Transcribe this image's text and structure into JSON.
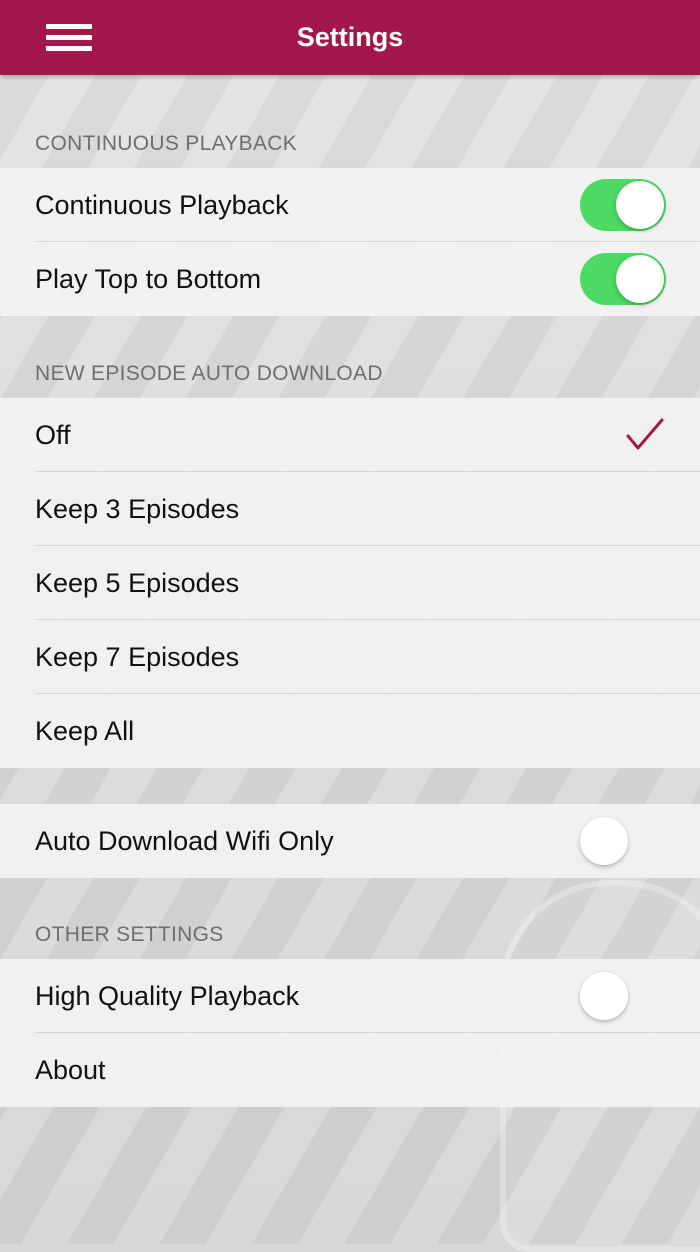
{
  "nav": {
    "title": "Settings",
    "menu_icon": "hamburger-menu-icon"
  },
  "sections": {
    "continuous": {
      "header": "CONTINUOUS PLAYBACK",
      "rows": [
        {
          "label": "Continuous Playback",
          "toggle": true
        },
        {
          "label": "Play Top to Bottom",
          "toggle": true
        }
      ]
    },
    "auto_download": {
      "header": "NEW EPISODE AUTO DOWNLOAD",
      "selected": "Off",
      "rows": [
        {
          "label": "Off"
        },
        {
          "label": "Keep 3 Episodes"
        },
        {
          "label": "Keep 5 Episodes"
        },
        {
          "label": "Keep 7 Episodes"
        },
        {
          "label": "Keep All"
        }
      ]
    },
    "wifi": {
      "rows": [
        {
          "label": "Auto Download Wifi Only",
          "toggle": false
        }
      ]
    },
    "other": {
      "header": "OTHER SETTINGS",
      "rows": [
        {
          "label": "High Quality Playback",
          "toggle": false
        },
        {
          "label": "About"
        }
      ]
    }
  },
  "colors": {
    "brand": "#a3174a",
    "toggle_on": "#4cd964",
    "checkmark": "#a3174a"
  }
}
